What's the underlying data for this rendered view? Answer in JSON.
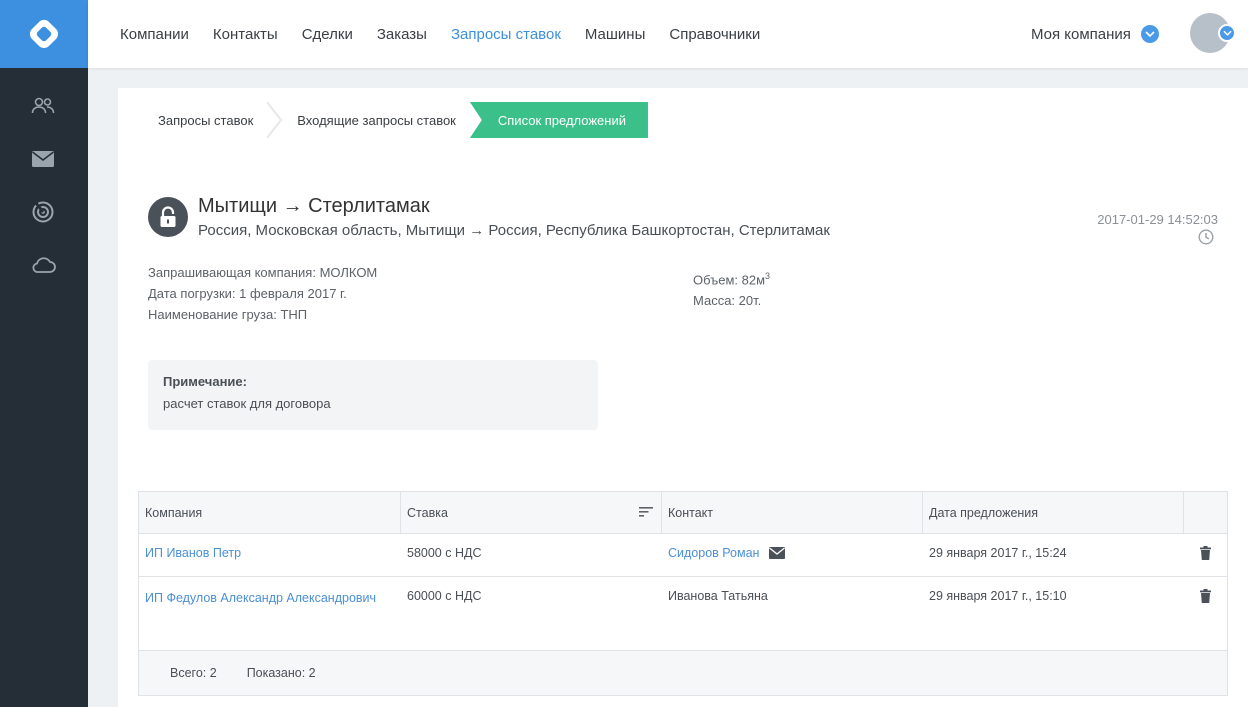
{
  "nav": {
    "items": [
      "Компании",
      "Контакты",
      "Сделки",
      "Заказы",
      "Запросы ставок",
      "Машины",
      "Справочники"
    ],
    "active_index": 4,
    "company_label": "Моя компания"
  },
  "sidebar": {
    "icons": [
      "users-icon",
      "mail-icon",
      "radar-icon",
      "cloud-icon"
    ]
  },
  "breadcrumb": {
    "items": [
      "Запросы ставок",
      "Входящие запросы ставок",
      "Список предложений"
    ]
  },
  "request": {
    "title_from": "Мытищи",
    "arrow": "→",
    "title_to": "Стерлитамак",
    "subtitle": "Россия, Московская область, Мытищи → Россия, Республика Башкортостан, Стерлитамак",
    "timestamp": "2017-01-29 14:52:03",
    "company_line": "Запрашивающая компания: МОЛКОМ",
    "date_line": "Дата погрузки: 1 февраля 2017 г.",
    "cargo_line": "Наименование груза: ТНП",
    "volume_label": "Объем: 82м",
    "volume_sup": "3",
    "mass_line": "Масса: 20т."
  },
  "note": {
    "title": "Примечание:",
    "text": "расчет ставок для договора"
  },
  "table": {
    "columns": [
      "Компания",
      "Ставка",
      "Контакт",
      "Дата предложения",
      ""
    ],
    "rows": [
      {
        "company": "ИП Иванов Петр",
        "rate": "58000 с НДС",
        "contact": "Сидоров Роман",
        "contact_link": true,
        "date": "29 января 2017 г., 15:24"
      },
      {
        "company": "ИП Федулов Александр Александрович",
        "rate": "60000 с НДС",
        "contact": "Иванова Татьяна",
        "contact_link": false,
        "date": "29 января 2017 г., 15:10"
      }
    ],
    "footer": {
      "total": "Всего: 2",
      "shown": "Показано: 2"
    }
  },
  "colors": {
    "accent": "#3d8fe0",
    "sidebar": "#252e36",
    "active_crumb": "#3cc08a",
    "link": "#4b8fd6"
  }
}
